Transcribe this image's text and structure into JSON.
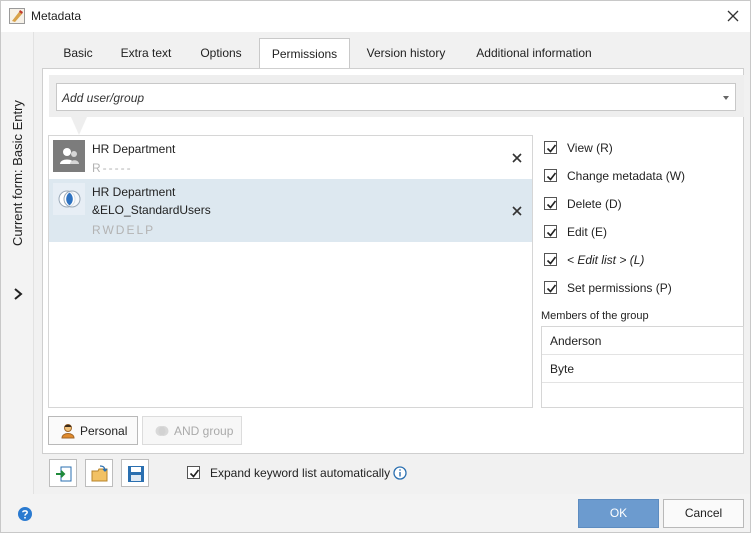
{
  "window": {
    "title": "Metadata"
  },
  "sidebar": {
    "vertical_label": "Current form: Basic Entry"
  },
  "tabs": [
    {
      "label": "Basic",
      "active": false
    },
    {
      "label": "Extra text",
      "active": false
    },
    {
      "label": "Options",
      "active": false
    },
    {
      "label": "Permissions",
      "active": true
    },
    {
      "label": "Version history",
      "active": false
    },
    {
      "label": "Additional information",
      "active": false
    }
  ],
  "add_user": {
    "placeholder": "Add user/group"
  },
  "entries": [
    {
      "name": "HR Department",
      "name2": "",
      "perms": "R-----",
      "icon": "user-icon",
      "selected": false
    },
    {
      "name": "HR Department",
      "name2": "&ELO_StandardUsers",
      "perms": "RWDELP",
      "icon": "group-intersection-icon",
      "selected": true
    }
  ],
  "permissions": [
    {
      "label": "View (R)",
      "checked": true,
      "italic": false
    },
    {
      "label": "Change metadata (W)",
      "checked": true,
      "italic": false
    },
    {
      "label": "Delete (D)",
      "checked": true,
      "italic": false
    },
    {
      "label": "Edit (E)",
      "checked": true,
      "italic": false
    },
    {
      "label": "< Edit list > (L)",
      "checked": true,
      "italic": true
    },
    {
      "label": "Set permissions (P)",
      "checked": true,
      "italic": false
    }
  ],
  "members": {
    "title": "Members of the group",
    "items": [
      "Anderson",
      "Byte",
      ""
    ]
  },
  "buttons": {
    "personal": "Personal",
    "and_group": "AND group",
    "ok": "OK",
    "cancel": "Cancel"
  },
  "options": {
    "expand_keyword": "Expand keyword list automatically",
    "expand_keyword_checked": true
  },
  "colors": {
    "accent": "#6c9bcf",
    "selection": "#dde8f0"
  }
}
